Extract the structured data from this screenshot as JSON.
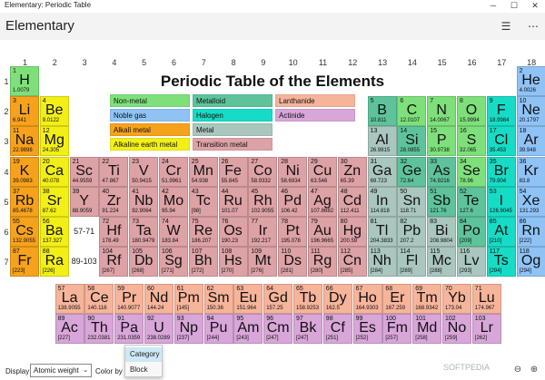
{
  "window": {
    "title": "Elementary: Periodic Table",
    "minimize": "─",
    "maximize": "☐",
    "close": "✕"
  },
  "appbar": {
    "title": "Elementary",
    "icon_list": "☰",
    "icon_more": "⋯"
  },
  "table_title": "Periodic Table of the Elements",
  "colors": {
    "Non-metal": "#7ee07a",
    "Noble gas": "#8fc3f6",
    "Alkali metal": "#f7a21c",
    "Alkaline earth metal": "#f2ef17",
    "Metalloid": "#5ec39b",
    "Halogen": "#16dcc6",
    "Metal": "#a9c6bf",
    "Transition metal": "#dda2a6",
    "Lanthanide": "#f6b49a",
    "Actinide": "#d8a6d8"
  },
  "legend": [
    {
      "label": "Non-metal",
      "cat": "Non-metal"
    },
    {
      "label": "Noble gas",
      "cat": "Noble gas"
    },
    {
      "label": "Alkali metal",
      "cat": "Alkali metal"
    },
    {
      "label": "Alkaline earth metal",
      "cat": "Alkaline earth metal"
    },
    {
      "label": "Metalloid",
      "cat": "Metalloid"
    },
    {
      "label": "Halogen",
      "cat": "Halogen"
    },
    {
      "label": "Metal",
      "cat": "Metal"
    },
    {
      "label": "Transition metal",
      "cat": "Transition metal"
    },
    {
      "label": "Lanthanide",
      "cat": "Lanthanide"
    },
    {
      "label": "Actinide",
      "cat": "Actinide"
    }
  ],
  "group_numbers": [
    "1",
    "2",
    "3",
    "4",
    "5",
    "6",
    "7",
    "8",
    "9",
    "10",
    "11",
    "12",
    "13",
    "14",
    "15",
    "16",
    "17",
    "18"
  ],
  "period_numbers": [
    "1",
    "2",
    "3",
    "4",
    "5",
    "6",
    "7"
  ],
  "placeholders": [
    "57-71",
    "89-103"
  ],
  "elements": [
    {
      "z": "1",
      "s": "H",
      "w": "1.0079",
      "g": 1,
      "p": 1,
      "c": "Non-metal"
    },
    {
      "z": "2",
      "s": "He",
      "w": "4.0026",
      "g": 18,
      "p": 1,
      "c": "Noble gas"
    },
    {
      "z": "3",
      "s": "Li",
      "w": "6.941",
      "g": 1,
      "p": 2,
      "c": "Alkali metal"
    },
    {
      "z": "4",
      "s": "Be",
      "w": "9.0122",
      "g": 2,
      "p": 2,
      "c": "Alkaline earth metal"
    },
    {
      "z": "5",
      "s": "B",
      "w": "10.811",
      "g": 13,
      "p": 2,
      "c": "Metalloid"
    },
    {
      "z": "6",
      "s": "C",
      "w": "12.0107",
      "g": 14,
      "p": 2,
      "c": "Non-metal"
    },
    {
      "z": "7",
      "s": "N",
      "w": "14.0067",
      "g": 15,
      "p": 2,
      "c": "Non-metal"
    },
    {
      "z": "8",
      "s": "O",
      "w": "15.9994",
      "g": 16,
      "p": 2,
      "c": "Non-metal"
    },
    {
      "z": "9",
      "s": "F",
      "w": "18.9984",
      "g": 17,
      "p": 2,
      "c": "Halogen"
    },
    {
      "z": "10",
      "s": "Ne",
      "w": "20.1797",
      "g": 18,
      "p": 2,
      "c": "Noble gas"
    },
    {
      "z": "11",
      "s": "Na",
      "w": "22.9898",
      "g": 1,
      "p": 3,
      "c": "Alkali metal"
    },
    {
      "z": "12",
      "s": "Mg",
      "w": "24.305",
      "g": 2,
      "p": 3,
      "c": "Alkaline earth metal"
    },
    {
      "z": "13",
      "s": "Al",
      "w": "26.9815",
      "g": 13,
      "p": 3,
      "c": "Metal"
    },
    {
      "z": "14",
      "s": "Si",
      "w": "28.0855",
      "g": 14,
      "p": 3,
      "c": "Metalloid"
    },
    {
      "z": "15",
      "s": "P",
      "w": "30.9738",
      "g": 15,
      "p": 3,
      "c": "Non-metal"
    },
    {
      "z": "16",
      "s": "S",
      "w": "32.065",
      "g": 16,
      "p": 3,
      "c": "Non-metal"
    },
    {
      "z": "17",
      "s": "Cl",
      "w": "35.453",
      "g": 17,
      "p": 3,
      "c": "Halogen"
    },
    {
      "z": "18",
      "s": "Ar",
      "w": "39.948",
      "g": 18,
      "p": 3,
      "c": "Noble gas"
    },
    {
      "z": "19",
      "s": "K",
      "w": "39.0983",
      "g": 1,
      "p": 4,
      "c": "Alkali metal"
    },
    {
      "z": "20",
      "s": "Ca",
      "w": "40.078",
      "g": 2,
      "p": 4,
      "c": "Alkaline earth metal"
    },
    {
      "z": "21",
      "s": "Sc",
      "w": "44.9559",
      "g": 3,
      "p": 4,
      "c": "Transition metal"
    },
    {
      "z": "22",
      "s": "Ti",
      "w": "47.867",
      "g": 4,
      "p": 4,
      "c": "Transition metal"
    },
    {
      "z": "23",
      "s": "V",
      "w": "50.9415",
      "g": 5,
      "p": 4,
      "c": "Transition metal"
    },
    {
      "z": "24",
      "s": "Cr",
      "w": "51.9961",
      "g": 6,
      "p": 4,
      "c": "Transition metal"
    },
    {
      "z": "25",
      "s": "Mn",
      "w": "54.938",
      "g": 7,
      "p": 4,
      "c": "Transition metal"
    },
    {
      "z": "26",
      "s": "Fe",
      "w": "55.845",
      "g": 8,
      "p": 4,
      "c": "Transition metal"
    },
    {
      "z": "27",
      "s": "Co",
      "w": "58.9332",
      "g": 9,
      "p": 4,
      "c": "Transition metal"
    },
    {
      "z": "28",
      "s": "Ni",
      "w": "58.6934",
      "g": 10,
      "p": 4,
      "c": "Transition metal"
    },
    {
      "z": "29",
      "s": "Cu",
      "w": "63.546",
      "g": 11,
      "p": 4,
      "c": "Transition metal"
    },
    {
      "z": "30",
      "s": "Zn",
      "w": "65.39",
      "g": 12,
      "p": 4,
      "c": "Transition metal"
    },
    {
      "z": "31",
      "s": "Ga",
      "w": "69.723",
      "g": 13,
      "p": 4,
      "c": "Metal"
    },
    {
      "z": "32",
      "s": "Ge",
      "w": "72.64",
      "g": 14,
      "p": 4,
      "c": "Metalloid"
    },
    {
      "z": "33",
      "s": "As",
      "w": "74.9216",
      "g": 15,
      "p": 4,
      "c": "Metalloid"
    },
    {
      "z": "34",
      "s": "Se",
      "w": "78.96",
      "g": 16,
      "p": 4,
      "c": "Non-metal"
    },
    {
      "z": "35",
      "s": "Br",
      "w": "79.904",
      "g": 17,
      "p": 4,
      "c": "Halogen"
    },
    {
      "z": "36",
      "s": "Kr",
      "w": "83.8",
      "g": 18,
      "p": 4,
      "c": "Noble gas"
    },
    {
      "z": "37",
      "s": "Rb",
      "w": "85.4678",
      "g": 1,
      "p": 5,
      "c": "Alkali metal"
    },
    {
      "z": "38",
      "s": "Sr",
      "w": "87.62",
      "g": 2,
      "p": 5,
      "c": "Alkaline earth metal"
    },
    {
      "z": "39",
      "s": "Y",
      "w": "88.9059",
      "g": 3,
      "p": 5,
      "c": "Transition metal"
    },
    {
      "z": "40",
      "s": "Zr",
      "w": "91.224",
      "g": 4,
      "p": 5,
      "c": "Transition metal"
    },
    {
      "z": "41",
      "s": "Nb",
      "w": "92.9064",
      "g": 5,
      "p": 5,
      "c": "Transition metal"
    },
    {
      "z": "42",
      "s": "Mo",
      "w": "95.94",
      "g": 6,
      "p": 5,
      "c": "Transition metal"
    },
    {
      "z": "43",
      "s": "Tc",
      "w": "[98]",
      "g": 7,
      "p": 5,
      "c": "Transition metal"
    },
    {
      "z": "44",
      "s": "Ru",
      "w": "101.07",
      "g": 8,
      "p": 5,
      "c": "Transition metal"
    },
    {
      "z": "45",
      "s": "Rh",
      "w": "102.9055",
      "g": 9,
      "p": 5,
      "c": "Transition metal"
    },
    {
      "z": "46",
      "s": "Pd",
      "w": "106.42",
      "g": 10,
      "p": 5,
      "c": "Transition metal"
    },
    {
      "z": "47",
      "s": "Ag",
      "w": "107.8682",
      "g": 11,
      "p": 5,
      "c": "Transition metal"
    },
    {
      "z": "48",
      "s": "Cd",
      "w": "112.411",
      "g": 12,
      "p": 5,
      "c": "Transition metal"
    },
    {
      "z": "49",
      "s": "In",
      "w": "114.818",
      "g": 13,
      "p": 5,
      "c": "Metal"
    },
    {
      "z": "50",
      "s": "Sn",
      "w": "118.71",
      "g": 14,
      "p": 5,
      "c": "Metal"
    },
    {
      "z": "51",
      "s": "Sb",
      "w": "121.76",
      "g": 15,
      "p": 5,
      "c": "Metalloid"
    },
    {
      "z": "52",
      "s": "Te",
      "w": "127.6",
      "g": 16,
      "p": 5,
      "c": "Metalloid"
    },
    {
      "z": "53",
      "s": "I",
      "w": "126.9045",
      "g": 17,
      "p": 5,
      "c": "Halogen"
    },
    {
      "z": "54",
      "s": "Xe",
      "w": "131.293",
      "g": 18,
      "p": 5,
      "c": "Noble gas"
    },
    {
      "z": "55",
      "s": "Cs",
      "w": "132.9055",
      "g": 1,
      "p": 6,
      "c": "Alkali metal"
    },
    {
      "z": "56",
      "s": "Ba",
      "w": "137.327",
      "g": 2,
      "p": 6,
      "c": "Alkaline earth metal"
    },
    {
      "z": "72",
      "s": "Hf",
      "w": "178.49",
      "g": 4,
      "p": 6,
      "c": "Transition metal"
    },
    {
      "z": "73",
      "s": "Ta",
      "w": "180.9479",
      "g": 5,
      "p": 6,
      "c": "Transition metal"
    },
    {
      "z": "74",
      "s": "W",
      "w": "183.84",
      "g": 6,
      "p": 6,
      "c": "Transition metal"
    },
    {
      "z": "75",
      "s": "Re",
      "w": "186.207",
      "g": 7,
      "p": 6,
      "c": "Transition metal"
    },
    {
      "z": "76",
      "s": "Os",
      "w": "190.23",
      "g": 8,
      "p": 6,
      "c": "Transition metal"
    },
    {
      "z": "77",
      "s": "Ir",
      "w": "192.217",
      "g": 9,
      "p": 6,
      "c": "Transition metal"
    },
    {
      "z": "78",
      "s": "Pt",
      "w": "195.078",
      "g": 10,
      "p": 6,
      "c": "Transition metal"
    },
    {
      "z": "79",
      "s": "Au",
      "w": "196.9665",
      "g": 11,
      "p": 6,
      "c": "Transition metal"
    },
    {
      "z": "80",
      "s": "Hg",
      "w": "200.59",
      "g": 12,
      "p": 6,
      "c": "Transition metal"
    },
    {
      "z": "81",
      "s": "Tl",
      "w": "204.3833",
      "g": 13,
      "p": 6,
      "c": "Metal"
    },
    {
      "z": "82",
      "s": "Pb",
      "w": "207.2",
      "g": 14,
      "p": 6,
      "c": "Metal"
    },
    {
      "z": "83",
      "s": "Bi",
      "w": "208.9804",
      "g": 15,
      "p": 6,
      "c": "Metal"
    },
    {
      "z": "84",
      "s": "Po",
      "w": "[209]",
      "g": 16,
      "p": 6,
      "c": "Metalloid"
    },
    {
      "z": "85",
      "s": "At",
      "w": "[210]",
      "g": 17,
      "p": 6,
      "c": "Halogen"
    },
    {
      "z": "86",
      "s": "Rn",
      "w": "[222]",
      "g": 18,
      "p": 6,
      "c": "Noble gas"
    },
    {
      "z": "87",
      "s": "Fr",
      "w": "[223]",
      "g": 1,
      "p": 7,
      "c": "Alkali metal"
    },
    {
      "z": "88",
      "s": "Ra",
      "w": "[226]",
      "g": 2,
      "p": 7,
      "c": "Alkaline earth metal"
    },
    {
      "z": "104",
      "s": "Rf",
      "w": "[267]",
      "g": 4,
      "p": 7,
      "c": "Transition metal"
    },
    {
      "z": "105",
      "s": "Db",
      "w": "[268]",
      "g": 5,
      "p": 7,
      "c": "Transition metal"
    },
    {
      "z": "106",
      "s": "Sg",
      "w": "[271]",
      "g": 6,
      "p": 7,
      "c": "Transition metal"
    },
    {
      "z": "107",
      "s": "Bh",
      "w": "[272]",
      "g": 7,
      "p": 7,
      "c": "Transition metal"
    },
    {
      "z": "108",
      "s": "Hs",
      "w": "[270]",
      "g": 8,
      "p": 7,
      "c": "Transition metal"
    },
    {
      "z": "109",
      "s": "Mt",
      "w": "[276]",
      "g": 9,
      "p": 7,
      "c": "Transition metal"
    },
    {
      "z": "110",
      "s": "Ds",
      "w": "[281]",
      "g": 10,
      "p": 7,
      "c": "Transition metal"
    },
    {
      "z": "111",
      "s": "Rg",
      "w": "[280]",
      "g": 11,
      "p": 7,
      "c": "Transition metal"
    },
    {
      "z": "112",
      "s": "Cn",
      "w": "[285]",
      "g": 12,
      "p": 7,
      "c": "Transition metal"
    },
    {
      "z": "113",
      "s": "Nh",
      "w": "[284]",
      "g": 13,
      "p": 7,
      "c": "Metal"
    },
    {
      "z": "114",
      "s": "Fl",
      "w": "[289]",
      "g": 14,
      "p": 7,
      "c": "Metal"
    },
    {
      "z": "115",
      "s": "Mc",
      "w": "[288]",
      "g": 15,
      "p": 7,
      "c": "Metal"
    },
    {
      "z": "116",
      "s": "Lv",
      "w": "[293]",
      "g": 16,
      "p": 7,
      "c": "Metal"
    },
    {
      "z": "117",
      "s": "Ts",
      "w": "[294]",
      "g": 17,
      "p": 7,
      "c": "Halogen"
    },
    {
      "z": "118",
      "s": "Og",
      "w": "[294]",
      "g": 18,
      "p": 7,
      "c": "Noble gas"
    }
  ],
  "lanthanides": [
    {
      "z": "57",
      "s": "La",
      "w": "138.9055",
      "c": "Lanthanide"
    },
    {
      "z": "58",
      "s": "Ce",
      "w": "140.116",
      "c": "Lanthanide"
    },
    {
      "z": "59",
      "s": "Pr",
      "w": "140.9077",
      "c": "Lanthanide"
    },
    {
      "z": "60",
      "s": "Nd",
      "w": "144.24",
      "c": "Lanthanide"
    },
    {
      "z": "61",
      "s": "Pm",
      "w": "[145]",
      "c": "Lanthanide"
    },
    {
      "z": "62",
      "s": "Sm",
      "w": "150.36",
      "c": "Lanthanide"
    },
    {
      "z": "63",
      "s": "Eu",
      "w": "151.964",
      "c": "Lanthanide"
    },
    {
      "z": "64",
      "s": "Gd",
      "w": "157.25",
      "c": "Lanthanide"
    },
    {
      "z": "65",
      "s": "Tb",
      "w": "158.9253",
      "c": "Lanthanide"
    },
    {
      "z": "66",
      "s": "Dy",
      "w": "162.5",
      "c": "Lanthanide"
    },
    {
      "z": "67",
      "s": "Ho",
      "w": "164.9303",
      "c": "Lanthanide"
    },
    {
      "z": "68",
      "s": "Er",
      "w": "167.259",
      "c": "Lanthanide"
    },
    {
      "z": "69",
      "s": "Tm",
      "w": "168.9342",
      "c": "Lanthanide"
    },
    {
      "z": "70",
      "s": "Yb",
      "w": "173.04",
      "c": "Lanthanide"
    },
    {
      "z": "71",
      "s": "Lu",
      "w": "174.967",
      "c": "Lanthanide"
    }
  ],
  "actinides": [
    {
      "z": "89",
      "s": "Ac",
      "w": "[227]",
      "c": "Actinide"
    },
    {
      "z": "90",
      "s": "Th",
      "w": "232.0381",
      "c": "Actinide"
    },
    {
      "z": "91",
      "s": "Pa",
      "w": "231.0359",
      "c": "Actinide"
    },
    {
      "z": "92",
      "s": "U",
      "w": "238.0289",
      "c": "Actinide"
    },
    {
      "z": "93",
      "s": "Np",
      "w": "[237]",
      "c": "Actinide"
    },
    {
      "z": "94",
      "s": "Pu",
      "w": "[244]",
      "c": "Actinide"
    },
    {
      "z": "95",
      "s": "Am",
      "w": "[243]",
      "c": "Actinide"
    },
    {
      "z": "96",
      "s": "Cm",
      "w": "[247]",
      "c": "Actinide"
    },
    {
      "z": "97",
      "s": "Bk",
      "w": "[247]",
      "c": "Actinide"
    },
    {
      "z": "98",
      "s": "Cf",
      "w": "[251]",
      "c": "Actinide"
    },
    {
      "z": "99",
      "s": "Es",
      "w": "[252]",
      "c": "Actinide"
    },
    {
      "z": "100",
      "s": "Fm",
      "w": "[257]",
      "c": "Actinide"
    },
    {
      "z": "101",
      "s": "Md",
      "w": "[258]",
      "c": "Actinide"
    },
    {
      "z": "102",
      "s": "No",
      "w": "[259]",
      "c": "Actinide"
    },
    {
      "z": "103",
      "s": "Lr",
      "w": "[262]",
      "c": "Actinide"
    }
  ],
  "bottombar": {
    "display_label": "Display",
    "display_value": "Atomic weight",
    "colorby_label": "Color by",
    "popup_items": [
      "Category",
      "Block"
    ],
    "popup_selected": "Category",
    "zoom_out": "⊖",
    "zoom_in": "⊕",
    "watermark": "SOFTPEDIA"
  }
}
